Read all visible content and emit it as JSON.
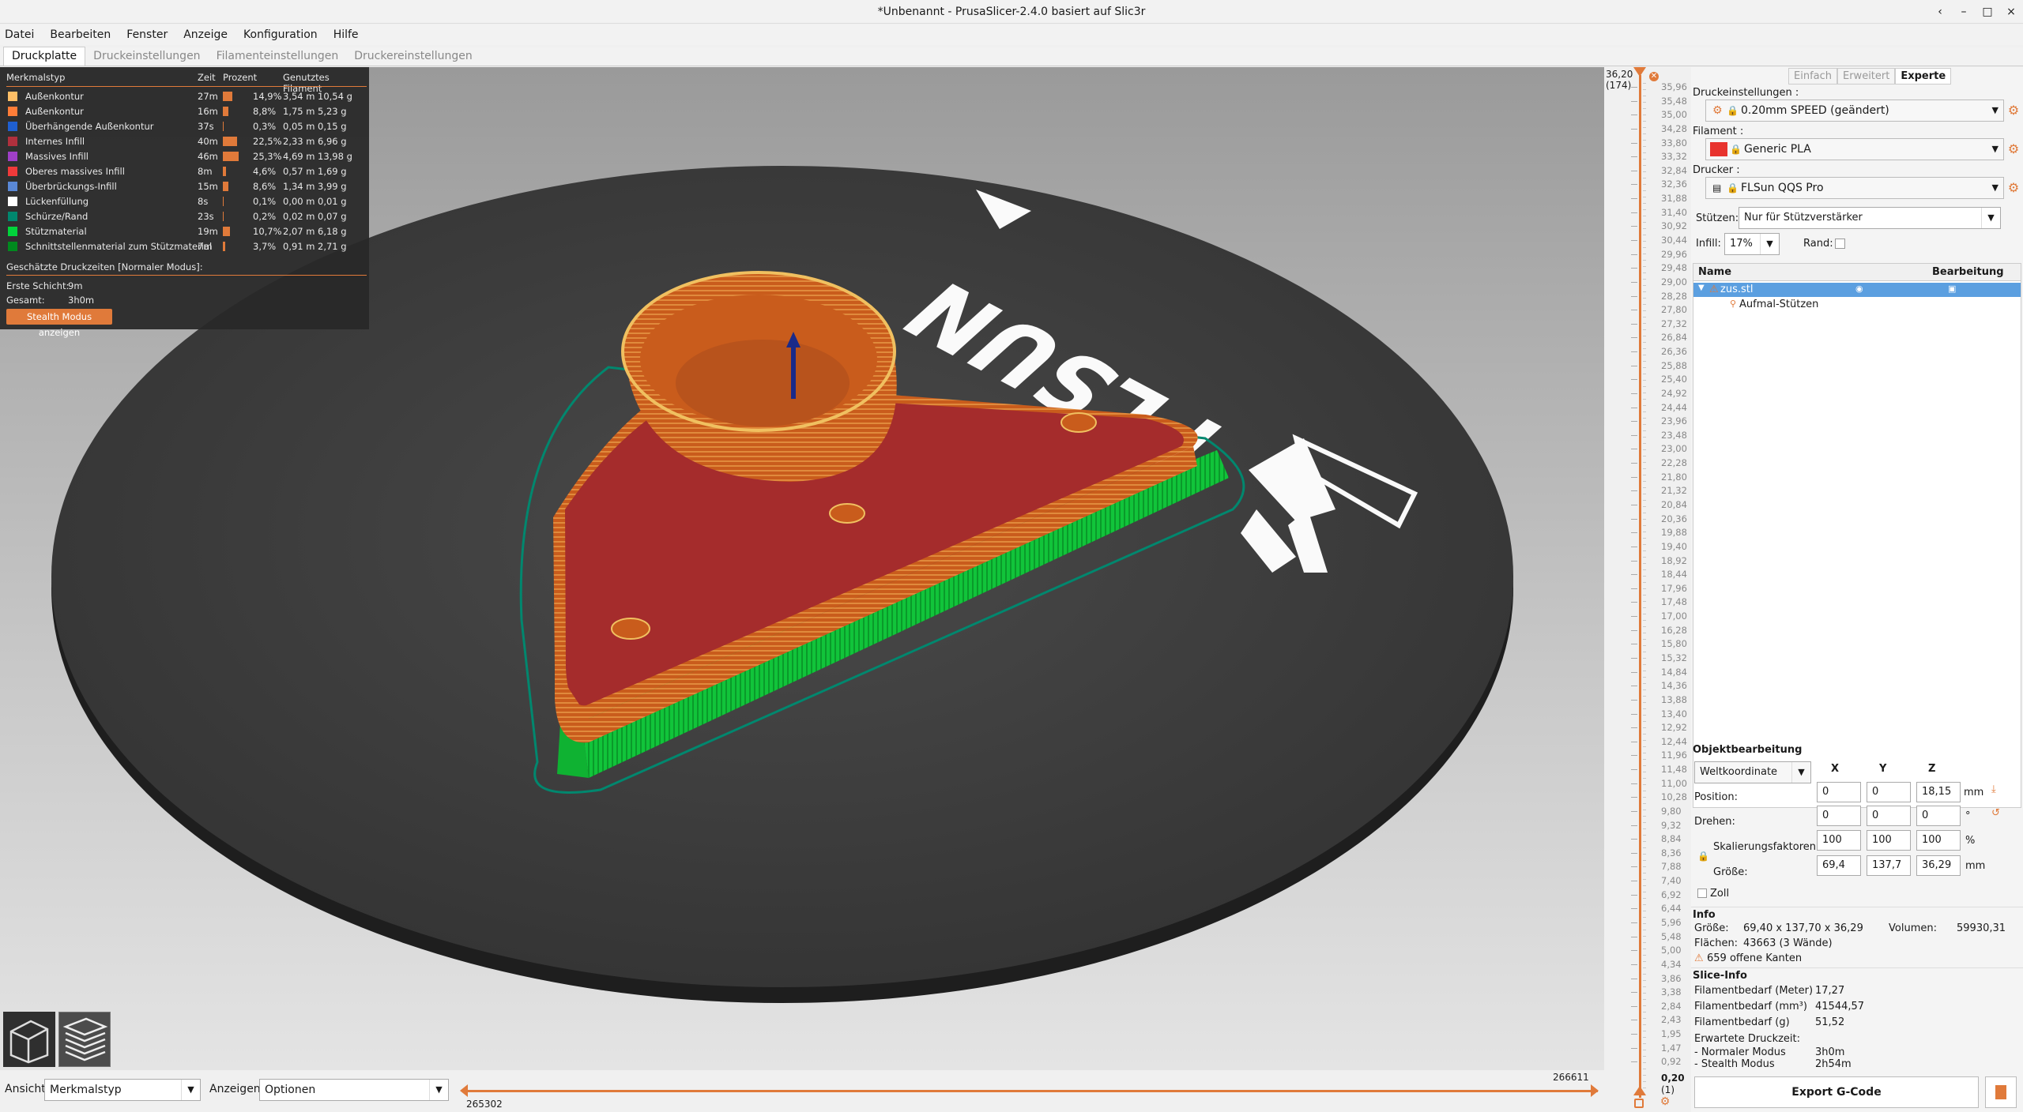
{
  "window": {
    "title": "*Unbenannt - PrusaSlicer-2.4.0 basiert auf Slic3r",
    "controls": [
      "‹",
      "–",
      "□",
      "×"
    ]
  },
  "menu": [
    "Datei",
    "Bearbeiten",
    "Fenster",
    "Anzeige",
    "Konfiguration",
    "Hilfe"
  ],
  "tabs": [
    "Druckplatte",
    "Druckeinstellungen",
    "Filamenteinstellungen",
    "Druckereinstellungen"
  ],
  "legend": {
    "headers": {
      "type": "Merkmalstyp",
      "time": "Zeit",
      "percent": "Prozent",
      "filament": "Genutztes Filament"
    },
    "rows": [
      {
        "name": "Außenkontur",
        "time": "27m",
        "percent": "14,9%",
        "share": 14.9,
        "m": "3,54 m",
        "g": "10,54 g",
        "color": "#ffbf66"
      },
      {
        "name": "Außenkontur",
        "time": "16m",
        "percent": "8,8%",
        "share": 8.8,
        "m": "1,75 m",
        "g": "5,23 g",
        "color": "#ff7d38"
      },
      {
        "name": "Überhängende Außenkontur",
        "time": "37s",
        "percent": "0,3%",
        "share": 0.3,
        "m": "0,05 m",
        "g": "0,15 g",
        "color": "#1f5fd0"
      },
      {
        "name": "Internes Infill",
        "time": "40m",
        "percent": "22,5%",
        "share": 22.5,
        "m": "2,33 m",
        "g": "6,96 g",
        "color": "#b0303d"
      },
      {
        "name": "Massives Infill",
        "time": "46m",
        "percent": "25,3%",
        "share": 25.3,
        "m": "4,69 m",
        "g": "13,98 g",
        "color": "#9f3fc7"
      },
      {
        "name": "Oberes massives Infill",
        "time": "8m",
        "percent": "4,6%",
        "share": 4.6,
        "m": "0,57 m",
        "g": "1,69 g",
        "color": "#f03a3a"
      },
      {
        "name": "Überbrückungs-Infill",
        "time": "15m",
        "percent": "8,6%",
        "share": 8.6,
        "m": "1,34 m",
        "g": "3,99 g",
        "color": "#5a88d6"
      },
      {
        "name": "Lückenfüllung",
        "time": "8s",
        "percent": "0,1%",
        "share": 0.1,
        "m": "0,00 m",
        "g": "0,01 g",
        "color": "#ffffff"
      },
      {
        "name": "Schürze/Rand",
        "time": "23s",
        "percent": "0,2%",
        "share": 0.2,
        "m": "0,02 m",
        "g": "0,07 g",
        "color": "#00876e"
      },
      {
        "name": "Stützmaterial",
        "time": "19m",
        "percent": "10,7%",
        "share": 10.7,
        "m": "2,07 m",
        "g": "6,18 g",
        "color": "#00d43b"
      },
      {
        "name": "Schnittstellenmaterial zum Stützmaterial",
        "time": "7m",
        "percent": "3,7%",
        "share": 3.7,
        "m": "0,91 m",
        "g": "2,71 g",
        "color": "#008a1e"
      }
    ],
    "estimate_title": "Geschätzte Druckzeiten [Normaler Modus]:",
    "first_layer_label": "Erste Schicht:",
    "first_layer": "9m",
    "total_label": "Gesamt:",
    "total": "3h0m",
    "stealth_button": "Stealth Modus anzeigen"
  },
  "bed_logo": "FLSUN",
  "bottom": {
    "view_label": "Ansicht",
    "view_value": "Merkmalstyp",
    "show_label": "Anzeigen",
    "show_value": "Optionen",
    "h_slider_left": "265302",
    "h_slider_right": "266611"
  },
  "layer_slider": {
    "top_value": "36,20",
    "top_layer": "(174)",
    "bottom_value": "0,20",
    "bottom_layer": "(1)",
    "ticks": [
      "35,96",
      "35,48",
      "35,00",
      "34,28",
      "33,80",
      "33,32",
      "32,84",
      "32,36",
      "31,88",
      "31,40",
      "30,92",
      "30,44",
      "29,96",
      "29,48",
      "29,00",
      "28,28",
      "27,80",
      "27,32",
      "26,84",
      "26,36",
      "25,88",
      "25,40",
      "24,92",
      "24,44",
      "23,96",
      "23,48",
      "23,00",
      "22,28",
      "21,80",
      "21,32",
      "20,84",
      "20,36",
      "19,88",
      "19,40",
      "18,92",
      "18,44",
      "17,96",
      "17,48",
      "17,00",
      "16,28",
      "15,80",
      "15,32",
      "14,84",
      "14,36",
      "13,88",
      "13,40",
      "12,92",
      "12,44",
      "11,96",
      "11,48",
      "11,00",
      "10,28",
      "9,80",
      "9,32",
      "8,84",
      "8,36",
      "7,88",
      "7,40",
      "6,92",
      "6,44",
      "5,96",
      "5,48",
      "5,00",
      "4,34",
      "3,86",
      "3,38",
      "2,84",
      "2,43",
      "1,95",
      "1,47",
      "0,92"
    ]
  },
  "right": {
    "modes": [
      "Einfach",
      "Erweitert",
      "Experte"
    ],
    "print_label": "Druckeinstellungen :",
    "print_value": "0.20mm SPEED (geändert)",
    "filament_label": "Filament :",
    "filament_value": "Generic PLA",
    "filament_color": "#e8332e",
    "printer_label": "Drucker :",
    "printer_value": "FLSun QQS Pro",
    "supports_label": "Stützen:",
    "supports_value": "Nur für Stützverstärker",
    "infill_label": "Infill:",
    "infill_value": "17%",
    "brim_label": "Rand:",
    "list_name": "Name",
    "list_edit": "Bearbeitung",
    "object": "zus.stl",
    "child": "Aufmal-Stützen",
    "manip_title": "Objektbearbeitung",
    "coord": "Weltkoordinate",
    "axes": [
      "X",
      "Y",
      "Z"
    ],
    "position_label": "Position:",
    "position": [
      "0",
      "0",
      "18,15"
    ],
    "position_unit": "mm",
    "rotate_label": "Drehen:",
    "rotate": [
      "0",
      "0",
      "0"
    ],
    "rotate_unit": "°",
    "scale_label": "Skalierungsfaktoren:",
    "scale": [
      "100",
      "100",
      "100"
    ],
    "scale_unit": "%",
    "size_label": "Größe:",
    "size": [
      "69,4",
      "137,7",
      "36,29"
    ],
    "size_unit": "mm",
    "inch_label": "Zoll",
    "info_title": "Info",
    "info_size_label": "Größe:",
    "info_size": "69,40 x 137,70 x 36,29",
    "info_volume_label": "Volumen:",
    "info_volume": "59930,31",
    "info_faces_label": "Flächen:",
    "info_faces": "43663 (3 Wände)",
    "info_warning": "659 offene Kanten",
    "slice_title": "Slice-Info",
    "slice": [
      {
        "label": "Filamentbedarf (Meter)",
        "value": "17,27"
      },
      {
        "label": "Filamentbedarf (mm³)",
        "value": "41544,57"
      },
      {
        "label": "Filamentbedarf (g)",
        "value": "51,52"
      }
    ],
    "est_label": "Erwartete Druckzeit:",
    "normal_label": "- Normaler Modus",
    "normal": "3h0m",
    "stealth_label": "- Stealth Modus",
    "stealth": "2h54m",
    "export": "Export G-Code"
  }
}
